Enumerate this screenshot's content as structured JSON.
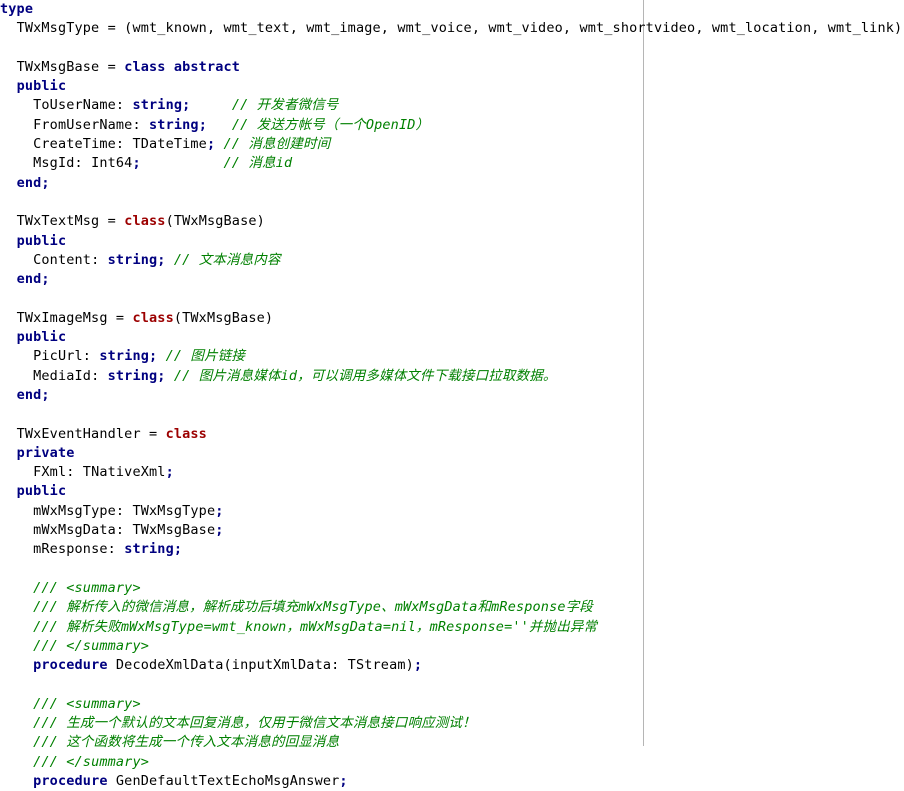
{
  "editor": {
    "name": "pascal-source-view",
    "language": "Object Pascal / Delphi",
    "background_color": "#ffffff",
    "text_color": "#000000",
    "keyword_color": "#000080",
    "class_keyword_color": "#9c0000",
    "comment_color": "#008000",
    "margin_guide_color": "#b5b5b5",
    "margin_guide_x": 643
  },
  "lines": [
    {
      "n": 1,
      "indent": 0,
      "segments": [
        {
          "t": "kw",
          "s": "type"
        }
      ]
    },
    {
      "n": 2,
      "indent": 2,
      "segments": [
        {
          "t": "txt",
          "s": "TWxMsgType = (wmt_known, wmt_text, wmt_image, wmt_voice, wmt_video, wmt_shortvideo, wmt_location, wmt_link)"
        },
        {
          "t": "pun",
          "s": ";"
        }
      ]
    },
    {
      "n": 3,
      "indent": 0,
      "segments": []
    },
    {
      "n": 4,
      "indent": 2,
      "segments": [
        {
          "t": "txt",
          "s": "TWxMsgBase = "
        },
        {
          "t": "kw",
          "s": "class abstract"
        }
      ]
    },
    {
      "n": 5,
      "indent": 2,
      "segments": [
        {
          "t": "kw",
          "s": "public"
        }
      ]
    },
    {
      "n": 6,
      "indent": 4,
      "segments": [
        {
          "t": "txt",
          "s": "ToUserName: "
        },
        {
          "t": "kw",
          "s": "string"
        },
        {
          "t": "pun",
          "s": ";"
        },
        {
          "t": "txt",
          "s": "     "
        },
        {
          "t": "cmt",
          "s": "// 开发者微信号"
        }
      ]
    },
    {
      "n": 7,
      "indent": 4,
      "segments": [
        {
          "t": "txt",
          "s": "FromUserName: "
        },
        {
          "t": "kw",
          "s": "string"
        },
        {
          "t": "pun",
          "s": ";"
        },
        {
          "t": "txt",
          "s": "   "
        },
        {
          "t": "cmt",
          "s": "// 发送方帐号（一个OpenID）"
        }
      ]
    },
    {
      "n": 8,
      "indent": 4,
      "segments": [
        {
          "t": "txt",
          "s": "CreateTime: TDateTime"
        },
        {
          "t": "pun",
          "s": ";"
        },
        {
          "t": "txt",
          "s": " "
        },
        {
          "t": "cmt",
          "s": "// 消息创建时间"
        }
      ]
    },
    {
      "n": 9,
      "indent": 4,
      "segments": [
        {
          "t": "txt",
          "s": "MsgId: Int64"
        },
        {
          "t": "pun",
          "s": ";"
        },
        {
          "t": "txt",
          "s": "          "
        },
        {
          "t": "cmt",
          "s": "// 消息id"
        }
      ]
    },
    {
      "n": 10,
      "indent": 2,
      "segments": [
        {
          "t": "kw",
          "s": "end"
        },
        {
          "t": "pun",
          "s": ";"
        }
      ]
    },
    {
      "n": 11,
      "indent": 0,
      "segments": []
    },
    {
      "n": 12,
      "indent": 2,
      "segments": [
        {
          "t": "txt",
          "s": "TWxTextMsg = "
        },
        {
          "t": "kw-red",
          "s": "class"
        },
        {
          "t": "txt",
          "s": "(TWxMsgBase)"
        }
      ]
    },
    {
      "n": 13,
      "indent": 2,
      "segments": [
        {
          "t": "kw",
          "s": "public"
        }
      ]
    },
    {
      "n": 14,
      "indent": 4,
      "segments": [
        {
          "t": "txt",
          "s": "Content: "
        },
        {
          "t": "kw",
          "s": "string"
        },
        {
          "t": "pun",
          "s": ";"
        },
        {
          "t": "txt",
          "s": " "
        },
        {
          "t": "cmt",
          "s": "// 文本消息内容"
        }
      ]
    },
    {
      "n": 15,
      "indent": 2,
      "segments": [
        {
          "t": "kw",
          "s": "end"
        },
        {
          "t": "pun",
          "s": ";"
        }
      ]
    },
    {
      "n": 16,
      "indent": 0,
      "segments": []
    },
    {
      "n": 17,
      "indent": 2,
      "segments": [
        {
          "t": "txt",
          "s": "TWxImageMsg = "
        },
        {
          "t": "kw-red",
          "s": "class"
        },
        {
          "t": "txt",
          "s": "(TWxMsgBase)"
        }
      ]
    },
    {
      "n": 18,
      "indent": 2,
      "segments": [
        {
          "t": "kw",
          "s": "public"
        }
      ]
    },
    {
      "n": 19,
      "indent": 4,
      "segments": [
        {
          "t": "txt",
          "s": "PicUrl: "
        },
        {
          "t": "kw",
          "s": "string"
        },
        {
          "t": "pun",
          "s": ";"
        },
        {
          "t": "txt",
          "s": " "
        },
        {
          "t": "cmt",
          "s": "// 图片链接"
        }
      ]
    },
    {
      "n": 20,
      "indent": 4,
      "segments": [
        {
          "t": "txt",
          "s": "MediaId: "
        },
        {
          "t": "kw",
          "s": "string"
        },
        {
          "t": "pun",
          "s": ";"
        },
        {
          "t": "txt",
          "s": " "
        },
        {
          "t": "cmt",
          "s": "// 图片消息媒体id，可以调用多媒体文件下载接口拉取数据。"
        }
      ]
    },
    {
      "n": 21,
      "indent": 2,
      "segments": [
        {
          "t": "kw",
          "s": "end"
        },
        {
          "t": "pun",
          "s": ";"
        }
      ]
    },
    {
      "n": 22,
      "indent": 0,
      "segments": []
    },
    {
      "n": 23,
      "indent": 2,
      "segments": [
        {
          "t": "txt",
          "s": "TWxEventHandler = "
        },
        {
          "t": "kw-red",
          "s": "class"
        }
      ]
    },
    {
      "n": 24,
      "indent": 2,
      "segments": [
        {
          "t": "kw",
          "s": "private"
        }
      ]
    },
    {
      "n": 25,
      "indent": 4,
      "segments": [
        {
          "t": "txt",
          "s": "FXml: TNativeXml"
        },
        {
          "t": "pun",
          "s": ";"
        }
      ]
    },
    {
      "n": 26,
      "indent": 2,
      "segments": [
        {
          "t": "kw",
          "s": "public"
        }
      ]
    },
    {
      "n": 27,
      "indent": 4,
      "segments": [
        {
          "t": "txt",
          "s": "mWxMsgType: TWxMsgType"
        },
        {
          "t": "pun",
          "s": ";"
        }
      ]
    },
    {
      "n": 28,
      "indent": 4,
      "segments": [
        {
          "t": "txt",
          "s": "mWxMsgData: TWxMsgBase"
        },
        {
          "t": "pun",
          "s": ";"
        }
      ]
    },
    {
      "n": 29,
      "indent": 4,
      "segments": [
        {
          "t": "txt",
          "s": "mResponse: "
        },
        {
          "t": "kw",
          "s": "string"
        },
        {
          "t": "pun",
          "s": ";"
        }
      ]
    },
    {
      "n": 30,
      "indent": 0,
      "segments": []
    },
    {
      "n": 31,
      "indent": 4,
      "segments": [
        {
          "t": "cmt",
          "s": "/// <summary>"
        }
      ]
    },
    {
      "n": 32,
      "indent": 4,
      "segments": [
        {
          "t": "cmt",
          "s": "/// 解析传入的微信消息，解析成功后填充mWxMsgType、mWxMsgData和mResponse字段"
        }
      ]
    },
    {
      "n": 33,
      "indent": 4,
      "segments": [
        {
          "t": "cmt",
          "s": "/// 解析失败mWxMsgType=wmt_known，mWxMsgData=nil，mResponse=''并抛出异常"
        }
      ]
    },
    {
      "n": 34,
      "indent": 4,
      "segments": [
        {
          "t": "cmt",
          "s": "/// </summary>"
        }
      ]
    },
    {
      "n": 35,
      "indent": 4,
      "segments": [
        {
          "t": "kw",
          "s": "procedure"
        },
        {
          "t": "txt",
          "s": " DecodeXmlData(inputXmlData: TStream)"
        },
        {
          "t": "pun",
          "s": ";"
        }
      ]
    },
    {
      "n": 36,
      "indent": 0,
      "segments": []
    },
    {
      "n": 37,
      "indent": 4,
      "segments": [
        {
          "t": "cmt",
          "s": "/// <summary>"
        }
      ]
    },
    {
      "n": 38,
      "indent": 4,
      "segments": [
        {
          "t": "cmt",
          "s": "/// 生成一个默认的文本回复消息，仅用于微信文本消息接口响应测试！"
        }
      ]
    },
    {
      "n": 39,
      "indent": 4,
      "segments": [
        {
          "t": "cmt",
          "s": "/// 这个函数将生成一个传入文本消息的回显消息"
        }
      ]
    },
    {
      "n": 40,
      "indent": 4,
      "segments": [
        {
          "t": "cmt",
          "s": "/// </summary>"
        }
      ]
    },
    {
      "n": 41,
      "indent": 4,
      "segments": [
        {
          "t": "kw",
          "s": "procedure"
        },
        {
          "t": "txt",
          "s": " GenDefaultTextEchoMsgAnswer"
        },
        {
          "t": "pun",
          "s": ";"
        }
      ]
    }
  ]
}
